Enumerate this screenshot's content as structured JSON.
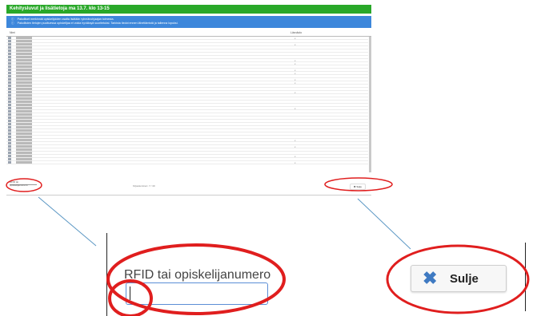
{
  "header": {
    "title": "Kehitysluvut ja lisätietoja ma 13.7. klo 13-15"
  },
  "info": {
    "line1": "Pakolliset merkinnät opiskelijoiden osalta lisätään ryhmänohjaajan toimesta.",
    "line2": "Pakollisten tietojen puuttuessa opiskelijaa ei voida hyväksyä suoritetuksi. Tarkista tiedot ennen lähettämistä ja tallenna lopuksi."
  },
  "table": {
    "col_name": "Nimi",
    "col_status": "Läsnäolo",
    "rows": [
      "x",
      "",
      "x",
      "",
      "",
      "",
      "",
      "x",
      "x",
      "",
      "x",
      "x",
      "",
      "x",
      "x",
      "",
      "",
      "x",
      "",
      "",
      "",
      "",
      "x",
      "",
      "",
      "",
      "",
      "",
      "",
      "",
      "",
      "",
      "x",
      "",
      "x",
      "",
      "",
      "x",
      "",
      "x"
    ]
  },
  "footer": {
    "rfid_small": "RFID tai opiskelijanumero",
    "mid_text": "Kirjautuminen: 7 / 40",
    "close_small": "✖ Sulje"
  },
  "zoom": {
    "rfid_label": "RFID tai opiskelijanumero",
    "rfid_value": "",
    "close_label": "Sulje"
  }
}
